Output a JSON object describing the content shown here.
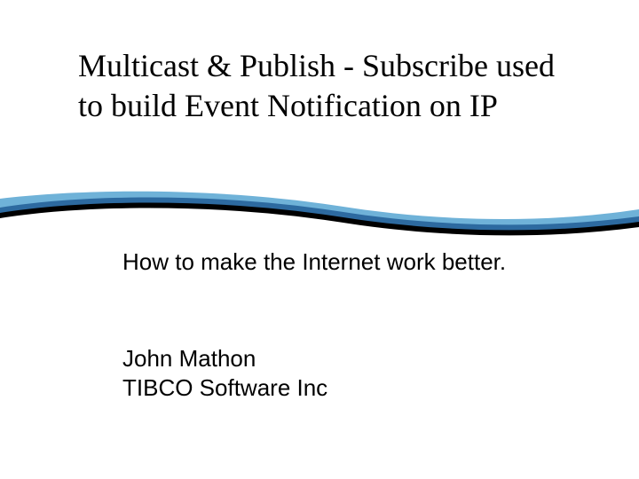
{
  "slide": {
    "title": "Multicast & Publish -  Subscribe used to build Event Notification on IP",
    "subtitle": "How to make the Internet work better.",
    "author_name": "John Mathon",
    "author_org": "TIBCO Software Inc"
  }
}
